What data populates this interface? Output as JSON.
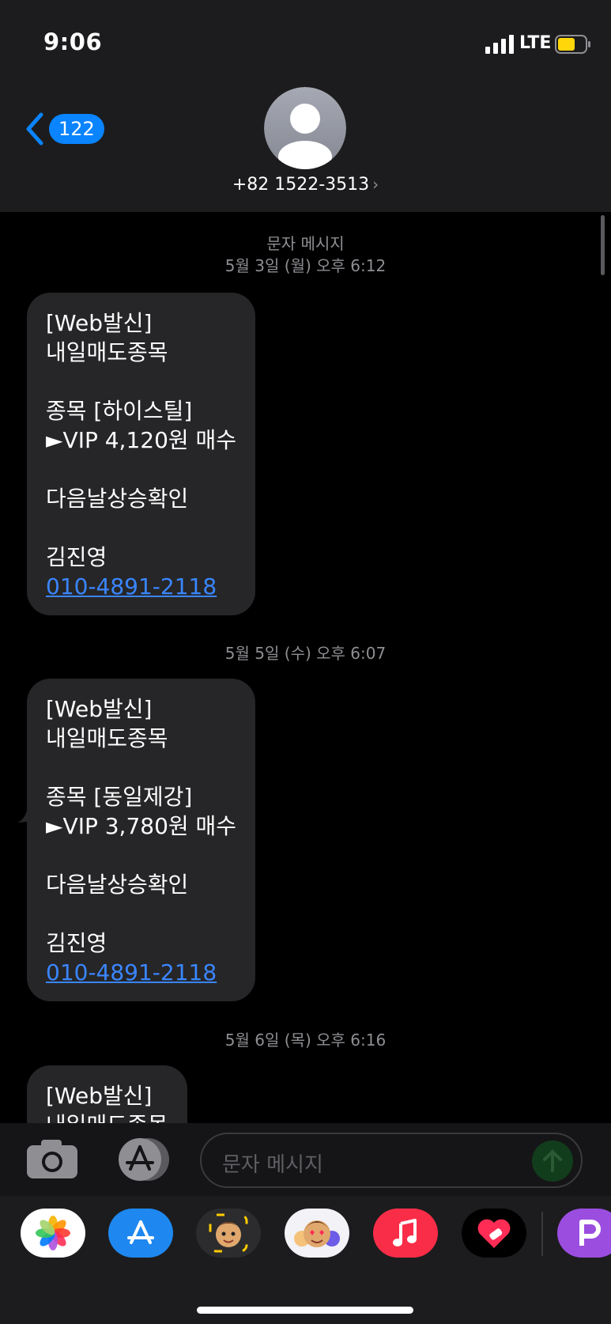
{
  "status_bar": {
    "time": "9:06",
    "network": "LTE"
  },
  "nav": {
    "back_count": "122",
    "contact": "+82 1522-3513",
    "chevron": "›"
  },
  "thread": {
    "service_label": "문자 메시지",
    "groups": [
      {
        "timestamp": "5월 3일 (월) 오후 6:12",
        "lines": [
          "[Web발신]",
          "내일매도종목",
          "",
          "종목 [하이스틸]",
          "►VIP 4,120원 매수",
          "",
          "다음날상승확인",
          "",
          "김진영"
        ],
        "phone": "010-4891-2118"
      },
      {
        "timestamp": "5월 5일 (수) 오후 6:07",
        "lines": [
          "[Web발신]",
          "내일매도종목",
          "",
          "종목 [동일제강]",
          "►VIP 3,780원 매수",
          "",
          "다음날상승확인",
          "",
          "김진영"
        ],
        "phone": "010-4891-2118"
      },
      {
        "timestamp": "5월 6일 (목) 오후 6:16",
        "lines": [
          "[Web발신]",
          "내일매도종목"
        ]
      }
    ]
  },
  "input": {
    "placeholder": "문자 메시지"
  },
  "dock": {
    "apps": [
      "photos-icon",
      "app-store-icon",
      "memoji-camera-icon",
      "memoji-stickers-icon",
      "music-icon",
      "heart-app-icon",
      "p-app-icon"
    ]
  },
  "colors": {
    "accent": "#0a84ff",
    "link": "#3a86ff",
    "bubble": "#262628",
    "battery": "#ffd60a"
  }
}
